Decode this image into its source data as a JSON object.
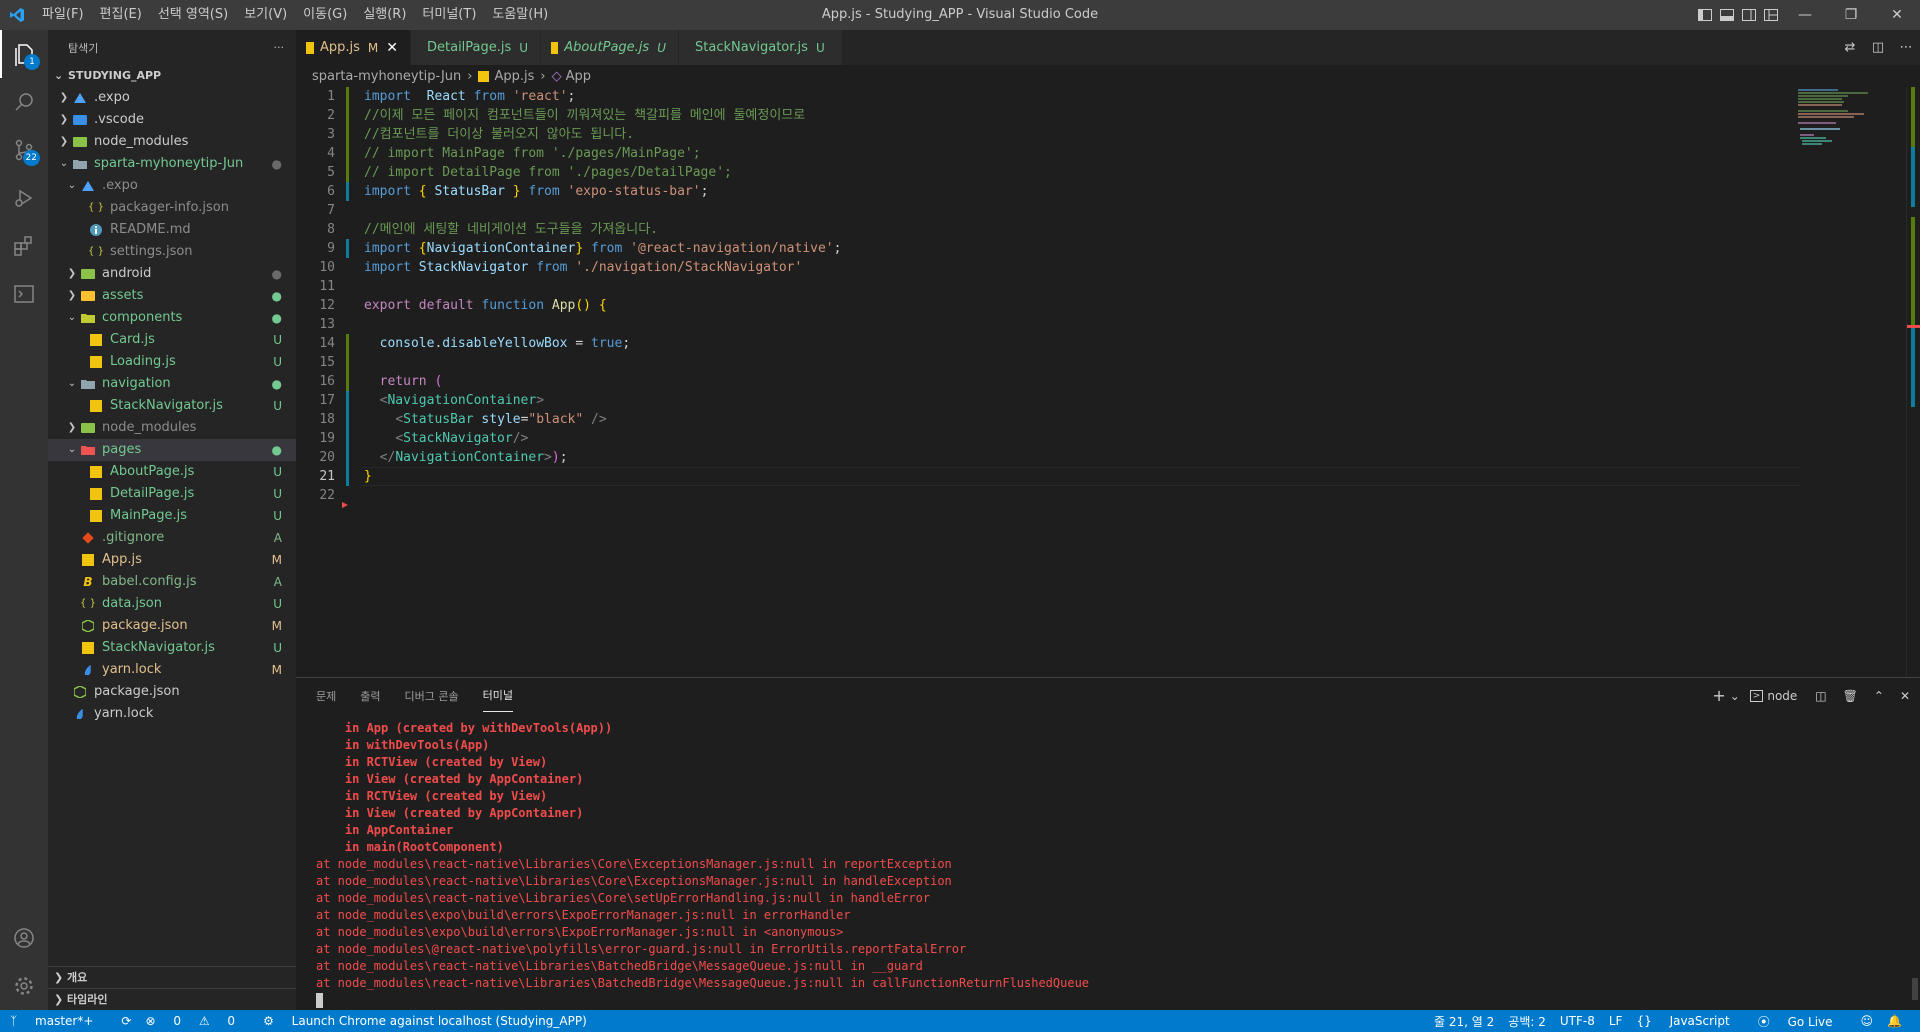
{
  "window": {
    "title": "App.js - Studying_APP - Visual Studio Code",
    "menu": [
      "파일(F)",
      "편집(E)",
      "선택 영역(S)",
      "보기(V)",
      "이동(G)",
      "실행(R)",
      "터미널(T)",
      "도움말(H)"
    ]
  },
  "activity": {
    "explorer_badge": "1",
    "scm_badge": "22"
  },
  "sidebar": {
    "header": "탐색기",
    "more": "···",
    "root": "STUDYING_APP",
    "items": [
      {
        "label": ".expo",
        "status": ""
      },
      {
        "label": ".vscode",
        "status": ""
      },
      {
        "label": "node_modules",
        "status": ""
      },
      {
        "label": "sparta-myhoneytip-Jun",
        "status": "●"
      },
      {
        "label": ".expo",
        "status": ""
      },
      {
        "label": "packager-info.json",
        "status": ""
      },
      {
        "label": "README.md",
        "status": ""
      },
      {
        "label": "settings.json",
        "status": ""
      },
      {
        "label": "android",
        "status": "●"
      },
      {
        "label": "assets",
        "status": "●"
      },
      {
        "label": "components",
        "status": "●"
      },
      {
        "label": "Card.js",
        "status": "U"
      },
      {
        "label": "Loading.js",
        "status": "U"
      },
      {
        "label": "navigation",
        "status": "●"
      },
      {
        "label": "StackNavigator.js",
        "status": "U"
      },
      {
        "label": "node_modules",
        "status": ""
      },
      {
        "label": "pages",
        "status": "●"
      },
      {
        "label": "AboutPage.js",
        "status": "U"
      },
      {
        "label": "DetailPage.js",
        "status": "U"
      },
      {
        "label": "MainPage.js",
        "status": "U"
      },
      {
        "label": ".gitignore",
        "status": "A"
      },
      {
        "label": "App.js",
        "status": "M"
      },
      {
        "label": "babel.config.js",
        "status": "A"
      },
      {
        "label": "data.json",
        "status": "U"
      },
      {
        "label": "package.json",
        "status": "M"
      },
      {
        "label": "StackNavigator.js",
        "status": "U"
      },
      {
        "label": "yarn.lock",
        "status": "M"
      },
      {
        "label": "package.json",
        "status": ""
      },
      {
        "label": "yarn.lock",
        "status": ""
      }
    ],
    "outline": "개요",
    "timeline": "타임라인"
  },
  "tabs": [
    {
      "label": "App.js",
      "mark": "M"
    },
    {
      "label": "DetailPage.js",
      "mark": "U"
    },
    {
      "label": "AboutPage.js",
      "mark": "U"
    },
    {
      "label": "StackNavigator.js",
      "mark": "U"
    }
  ],
  "breadcrumb": [
    "sparta-myhoneytip-Jun",
    "App.js",
    "App"
  ],
  "editor": {
    "line_numbers": [
      "1",
      "2",
      "3",
      "4",
      "5",
      "6",
      "7",
      "8",
      "9",
      "10",
      "11",
      "12",
      "13",
      "14",
      "15",
      "16",
      "17",
      "18",
      "19",
      "20",
      "21",
      "22"
    ],
    "lines": [
      [
        [
          "kb",
          "import"
        ],
        [
          "",
          "  "
        ],
        [
          "var",
          "React"
        ],
        [
          "",
          " "
        ],
        [
          "kb",
          "from"
        ],
        [
          "",
          " "
        ],
        [
          "str",
          "'react'"
        ],
        [
          "",
          ";"
        ]
      ],
      [
        [
          "cmt",
          "//이제 모든 페이지 컴포넌트들이 끼워져있는 책갈피를 메인에 둘예정이므로"
        ]
      ],
      [
        [
          "cmt",
          "//컴포넌트를 더이상 불러오지 않아도 됩니다."
        ]
      ],
      [
        [
          "cmt",
          "// import MainPage from './pages/MainPage';"
        ]
      ],
      [
        [
          "cmt",
          "// import DetailPage from './pages/DetailPage';"
        ]
      ],
      [
        [
          "kb",
          "import"
        ],
        [
          "",
          " "
        ],
        [
          "br1",
          "{"
        ],
        [
          "",
          " "
        ],
        [
          "var",
          "StatusBar"
        ],
        [
          "",
          " "
        ],
        [
          "br1",
          "}"
        ],
        [
          "",
          " "
        ],
        [
          "kb",
          "from"
        ],
        [
          "",
          " "
        ],
        [
          "str",
          "'expo-status-bar'"
        ],
        [
          "",
          ";"
        ]
      ],
      [
        [
          "",
          ""
        ]
      ],
      [
        [
          "cmt",
          "//메인에 세팅할 네비게이션 도구들을 가져옵니다."
        ]
      ],
      [
        [
          "kb",
          "import"
        ],
        [
          "",
          " "
        ],
        [
          "br1",
          "{"
        ],
        [
          "var",
          "NavigationContainer"
        ],
        [
          "br1",
          "}"
        ],
        [
          "",
          " "
        ],
        [
          "kb",
          "from"
        ],
        [
          "",
          " "
        ],
        [
          "str",
          "'@react-navigation/native'"
        ],
        [
          "",
          ";"
        ]
      ],
      [
        [
          "kb",
          "import"
        ],
        [
          "",
          " "
        ],
        [
          "var",
          "StackNavigator"
        ],
        [
          "",
          " "
        ],
        [
          "kb",
          "from"
        ],
        [
          "",
          " "
        ],
        [
          "str",
          "'./navigation/StackNavigator'"
        ]
      ],
      [
        [
          "",
          ""
        ]
      ],
      [
        [
          "kw",
          "export"
        ],
        [
          "",
          " "
        ],
        [
          "kw",
          "default"
        ],
        [
          "",
          " "
        ],
        [
          "kb",
          "function"
        ],
        [
          "",
          " "
        ],
        [
          "fn",
          "App"
        ],
        [
          "br1",
          "()"
        ],
        [
          "",
          " "
        ],
        [
          "br1",
          "{"
        ]
      ],
      [
        [
          "",
          ""
        ]
      ],
      [
        [
          "",
          "  "
        ],
        [
          "var",
          "console"
        ],
        [
          "",
          "."
        ],
        [
          "var",
          "disableYellowBox"
        ],
        [
          "",
          " = "
        ],
        [
          "kb",
          "true"
        ],
        [
          "",
          ";"
        ]
      ],
      [
        [
          "",
          ""
        ]
      ],
      [
        [
          "",
          "  "
        ],
        [
          "kw",
          "return"
        ],
        [
          "",
          " "
        ],
        [
          "br2",
          "("
        ]
      ],
      [
        [
          "",
          "  "
        ],
        [
          "tagp",
          "<"
        ],
        [
          "tag",
          "NavigationContainer"
        ],
        [
          "tagp",
          ">"
        ]
      ],
      [
        [
          "",
          "    "
        ],
        [
          "tagp",
          "<"
        ],
        [
          "tag",
          "StatusBar"
        ],
        [
          "",
          " "
        ],
        [
          "var",
          "style"
        ],
        [
          "",
          "="
        ],
        [
          "str",
          "\"black\""
        ],
        [
          "",
          " "
        ],
        [
          "tagp",
          "/>"
        ]
      ],
      [
        [
          "",
          "    "
        ],
        [
          "tagp",
          "<"
        ],
        [
          "tag",
          "StackNavigator"
        ],
        [
          "tagp",
          "/>"
        ]
      ],
      [
        [
          "",
          "  "
        ],
        [
          "tagp",
          "</"
        ],
        [
          "tag",
          "NavigationContainer"
        ],
        [
          "tagp",
          ">"
        ],
        [
          "br2",
          ")"
        ],
        [
          "",
          ";"
        ]
      ],
      [
        [
          "br1",
          "}"
        ]
      ],
      [
        [
          "",
          ""
        ]
      ]
    ]
  },
  "panel": {
    "tabs": [
      "문제",
      "출력",
      "디버그 콘솔",
      "터미널"
    ],
    "terminal_name": "node",
    "terminal_lines": [
      "    in App (created by withDevTools(App))",
      "    in withDevTools(App)",
      "    in RCTView (created by View)",
      "    in View (created by AppContainer)",
      "    in RCTView (created by View)",
      "    in View (created by AppContainer)",
      "    in AppContainer",
      "    in main(RootComponent)",
      "at node_modules\\react-native\\Libraries\\Core\\ExceptionsManager.js:null in reportException",
      "at node_modules\\react-native\\Libraries\\Core\\ExceptionsManager.js:null in handleException",
      "at node_modules\\react-native\\Libraries\\Core\\setUpErrorHandling.js:null in handleError",
      "at node_modules\\expo\\build\\errors\\ExpoErrorManager.js:null in errorHandler",
      "at node_modules\\expo\\build\\errors\\ExpoErrorManager.js:null in <anonymous>",
      "at node_modules\\@react-native\\polyfills\\error-guard.js:null in ErrorUtils.reportFatalError",
      "at node_modules\\react-native\\Libraries\\BatchedBridge\\MessageQueue.js:null in __guard",
      "at node_modules\\react-native\\Libraries\\BatchedBridge\\MessageQueue.js:null in callFunctionReturnFlushedQueue"
    ]
  },
  "statusbar": {
    "branch": "master*+",
    "errors": "0",
    "warnings": "0",
    "launch": "Launch Chrome against localhost (Studying_APP)",
    "position": "줄 21, 열 2",
    "spaces": "공백: 2",
    "encoding": "UTF-8",
    "eol": "LF",
    "language": "JavaScript",
    "golive": "Go Live"
  },
  "colors": {
    "statusbar": "#007acc",
    "modified": "#e2c08d",
    "untracked": "#73c991",
    "terminal_error": "#f14c4c"
  }
}
